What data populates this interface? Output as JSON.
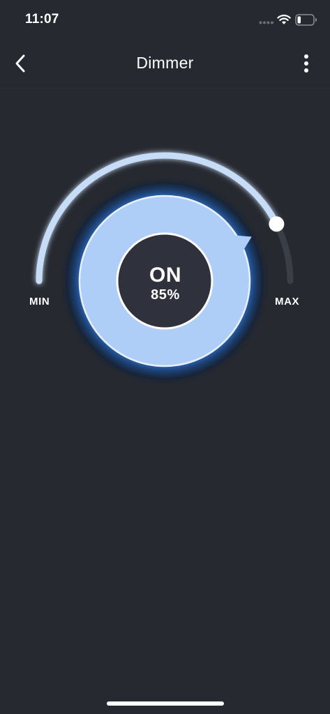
{
  "status_bar": {
    "time": "11:07"
  },
  "header": {
    "title": "Dimmer",
    "back_icon": "chevron-left-icon",
    "more_icon": "vertical-ellipsis-icon"
  },
  "dimmer": {
    "state": "ON",
    "level_text": "85%",
    "level": 85,
    "min_label": "MIN",
    "max_label": "MAX"
  },
  "colors": {
    "background": "#262930",
    "accent": "#aecdf7",
    "glow": "#3c82d8",
    "knob": "#ffffff",
    "center": "#2f323c"
  }
}
